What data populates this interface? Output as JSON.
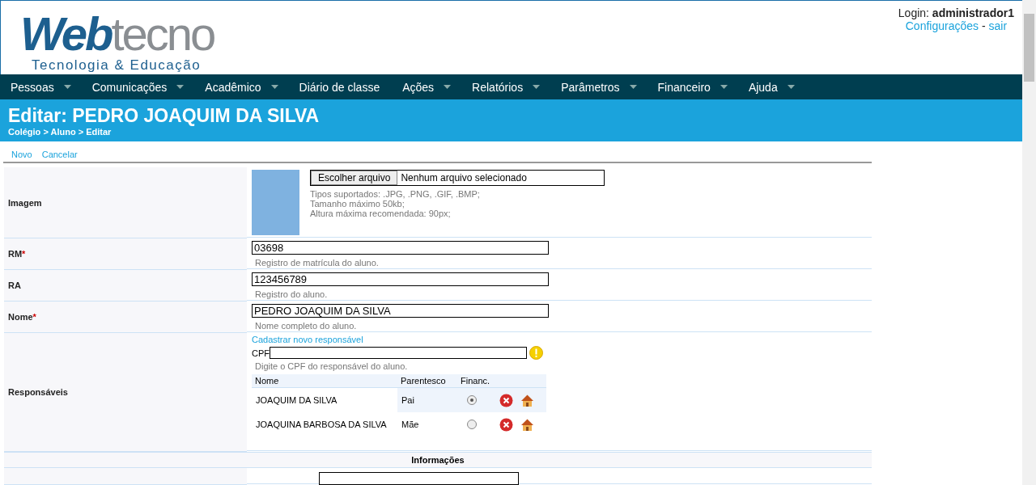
{
  "header": {
    "logo": {
      "part_1": "Web",
      "part_2": "tecno",
      "tagline": "Tecnologia & Educação"
    },
    "login_label": "Login:",
    "login_user": "administrador1",
    "links": [
      "Configurações",
      "sair"
    ],
    "link_separator": "-"
  },
  "menu": [
    {
      "label": "Pessoas",
      "has_dropdown": true
    },
    {
      "label": "Comunicações",
      "has_dropdown": true
    },
    {
      "label": "Acadêmico",
      "has_dropdown": true
    },
    {
      "label": "Diário de classe",
      "has_dropdown": false
    },
    {
      "label": "Ações",
      "has_dropdown": true
    },
    {
      "label": "Relatórios",
      "has_dropdown": true
    },
    {
      "label": "Parâmetros",
      "has_dropdown": true
    },
    {
      "label": "Financeiro",
      "has_dropdown": true
    },
    {
      "label": "Ajuda",
      "has_dropdown": true
    }
  ],
  "page_title": {
    "title": "Editar: PEDRO JOAQUIM DA SILVA",
    "breadcrumb": "Colégio > Aluno > Editar"
  },
  "actions": [
    "Novo",
    "Cancelar"
  ],
  "form": {
    "image": {
      "label": "Imagem",
      "button": "Escolher arquivo",
      "file_status": "Nenhum arquivo selecionado",
      "hints": [
        "Tipos suportados: .JPG, .PNG, .GIF, .BMP;",
        "Tamanho máximo 50kb;",
        "Altura máxima recomendada: 90px;"
      ]
    },
    "fields": [
      {
        "label": "RM",
        "required_mark": "*",
        "value": "03698",
        "hint": "Registro de matrícula do aluno."
      },
      {
        "label": "RA",
        "value": "123456789",
        "hint": "Registro do aluno."
      },
      {
        "label": "Nome",
        "required_mark": "*",
        "value": "PEDRO JOAQUIM DA SILVA",
        "hint": "Nome completo do aluno."
      }
    ],
    "guardians": {
      "label": "Responsáveis",
      "new_link": "Cadastrar novo responsável",
      "cpf_label": "CPF",
      "cpf_hint": "Digite o CPF do responsável do aluno.",
      "columns": [
        "Nome",
        "Parentesco",
        "Financ."
      ],
      "rows": [
        {
          "name": "JOAQUIM DA SILVA",
          "relation": "Pai",
          "selected": true,
          "highlighted": true
        },
        {
          "name": "JOAQUINA BARBOSA DA SILVA",
          "relation": "Mãe",
          "selected": false,
          "highlighted": false
        }
      ]
    },
    "section": "Informações"
  }
}
